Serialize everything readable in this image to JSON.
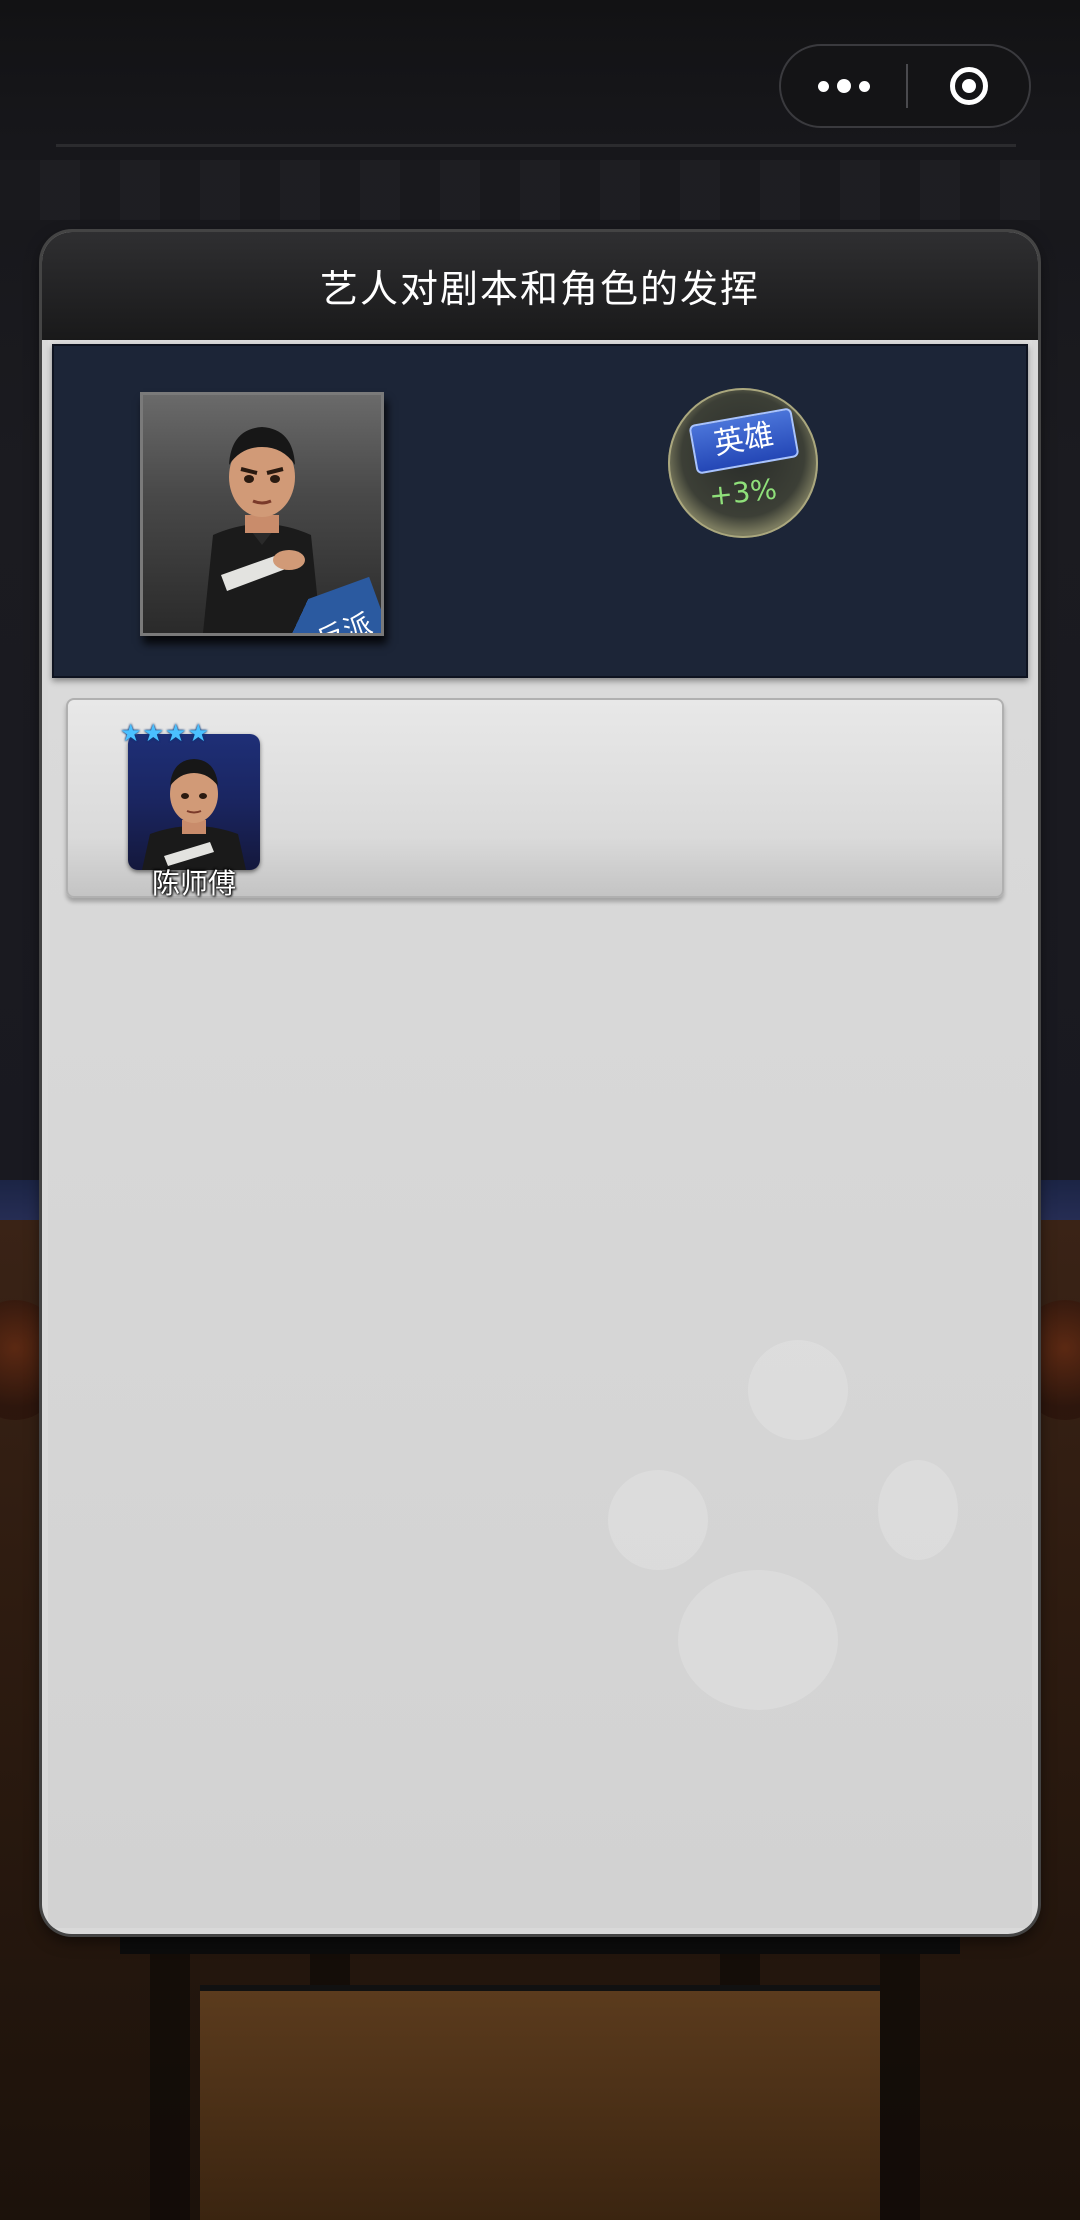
{
  "header": {
    "title": "艺人对剧本和角色的发挥"
  },
  "capsule": {
    "more_icon": "more-dots-icon",
    "close_icon": "target-circle-icon"
  },
  "role": {
    "tag": "反派",
    "bonus_label": "英雄",
    "bonus_value": "+3%"
  },
  "actors": [
    {
      "name": "陈师傅",
      "stars": 4,
      "star_glyph": "★"
    }
  ],
  "colors": {
    "panel": "#1c2537",
    "star": "#4ac0ff",
    "bonus_value": "#8fe07a",
    "bonus_label": "#2f5ccb"
  }
}
